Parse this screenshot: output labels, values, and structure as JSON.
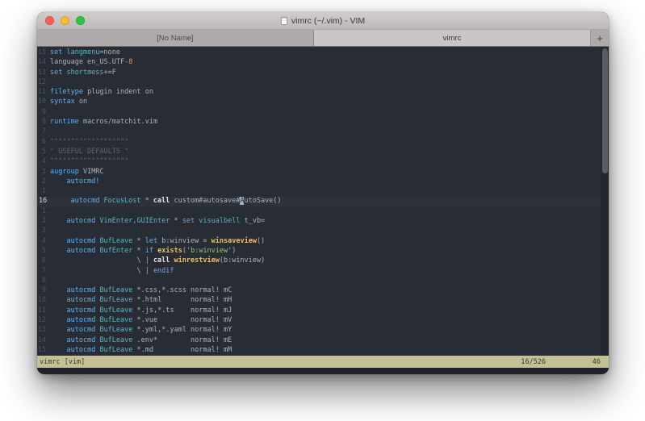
{
  "window": {
    "title": "vimrc (~/.vim) - VIM",
    "tabs": [
      {
        "label": "[No Name]",
        "active": false
      },
      {
        "label": "vimrc",
        "active": true
      }
    ],
    "new_tab_label": "+"
  },
  "theme": {
    "bg": "#282c34",
    "cursorline_bg": "#2c313a",
    "fg": "#abb2bf",
    "gutter": "#4b5263",
    "gutter_current": "#d7dae0",
    "blue": "#61afef",
    "cyan": "#56b6c2",
    "yellow": "#e5c07b",
    "green": "#98c379",
    "orange": "#d19a66",
    "comment": "#5f6672",
    "bright": "#dfe2e7",
    "cursor_bg": "#a9b2bf",
    "status_bg": "#c6c192",
    "status_fg": "#3a3829"
  },
  "editor": {
    "lines": [
      {
        "g": "15",
        "segments": [
          {
            "t": "set ",
            "c": "kw"
          },
          {
            "t": "langmenu",
            "c": "type"
          },
          {
            "t": "=none",
            "c": "pln"
          }
        ]
      },
      {
        "g": "14",
        "segments": [
          {
            "t": "language en_US.UTF",
            "c": "pln"
          },
          {
            "t": "-8",
            "c": "num"
          }
        ]
      },
      {
        "g": "13",
        "segments": [
          {
            "t": "set ",
            "c": "kw"
          },
          {
            "t": "shortmess",
            "c": "type"
          },
          {
            "t": "+=F",
            "c": "pln"
          }
        ]
      },
      {
        "g": "12",
        "segments": []
      },
      {
        "g": "11",
        "segments": [
          {
            "t": "filetype",
            "c": "kw"
          },
          {
            "t": " plugin indent on",
            "c": "pln"
          }
        ]
      },
      {
        "g": "10",
        "segments": [
          {
            "t": "syntax",
            "c": "kw"
          },
          {
            "t": " on",
            "c": "pln"
          }
        ]
      },
      {
        "g": "9",
        "segments": []
      },
      {
        "g": "8",
        "segments": [
          {
            "t": "runtime",
            "c": "kw"
          },
          {
            "t": " macros/matchit.vim",
            "c": "pln"
          }
        ]
      },
      {
        "g": "7",
        "segments": []
      },
      {
        "g": "6",
        "segments": [
          {
            "t": "\"\"\"\"\"\"\"\"\"\"\"\"\"\"\"\"\"\"\"",
            "c": "cmt"
          }
        ]
      },
      {
        "g": "5",
        "segments": [
          {
            "t": "\" USEFUL DEFAULTS \"",
            "c": "cmt"
          }
        ]
      },
      {
        "g": "4",
        "segments": [
          {
            "t": "\"\"\"\"\"\"\"\"\"\"\"\"\"\"\"\"\"\"\"",
            "c": "cmt"
          }
        ]
      },
      {
        "g": "3",
        "segments": [
          {
            "t": "augroup",
            "c": "kw"
          },
          {
            "t": " VIMRC",
            "c": "pln"
          }
        ]
      },
      {
        "g": "2",
        "segments": [
          {
            "t": "    ",
            "c": "pln"
          },
          {
            "t": "autocmd!",
            "c": "kw"
          }
        ]
      },
      {
        "g": "1",
        "segments": []
      },
      {
        "g": "16",
        "current": true,
        "segments": [
          {
            "t": "    ",
            "c": "pln"
          },
          {
            "t": "autocmd",
            "c": "kw"
          },
          {
            "t": " ",
            "c": "pln"
          },
          {
            "t": "FocusLost",
            "c": "type"
          },
          {
            "t": " * ",
            "c": "pln"
          },
          {
            "t": "call",
            "c": "cmd"
          },
          {
            "t": " custom#autosave#",
            "c": "pln"
          },
          {
            "t": "A",
            "c": "cursor"
          },
          {
            "t": "utoSave()",
            "c": "pln"
          }
        ]
      },
      {
        "g": "1",
        "segments": []
      },
      {
        "g": "2",
        "segments": [
          {
            "t": "    ",
            "c": "pln"
          },
          {
            "t": "autocmd",
            "c": "kw"
          },
          {
            "t": " ",
            "c": "pln"
          },
          {
            "t": "VimEnter,GUIEnter",
            "c": "type"
          },
          {
            "t": " * ",
            "c": "pln"
          },
          {
            "t": "set",
            "c": "kw"
          },
          {
            "t": " ",
            "c": "pln"
          },
          {
            "t": "visualbell",
            "c": "type"
          },
          {
            "t": " t_vb=",
            "c": "pln"
          }
        ]
      },
      {
        "g": "3",
        "segments": []
      },
      {
        "g": "4",
        "segments": [
          {
            "t": "    ",
            "c": "pln"
          },
          {
            "t": "autocmd",
            "c": "kw"
          },
          {
            "t": " ",
            "c": "pln"
          },
          {
            "t": "BufLeave",
            "c": "type"
          },
          {
            "t": " * ",
            "c": "pln"
          },
          {
            "t": "let",
            "c": "kw"
          },
          {
            "t": " b:winview = ",
            "c": "pln"
          },
          {
            "t": "winsaveview",
            "c": "fn"
          },
          {
            "t": "()",
            "c": "pln"
          }
        ]
      },
      {
        "g": "5",
        "segments": [
          {
            "t": "    ",
            "c": "pln"
          },
          {
            "t": "autocmd",
            "c": "kw"
          },
          {
            "t": " ",
            "c": "pln"
          },
          {
            "t": "BufEnter",
            "c": "type"
          },
          {
            "t": " * ",
            "c": "pln"
          },
          {
            "t": "if",
            "c": "kw"
          },
          {
            "t": " ",
            "c": "pln"
          },
          {
            "t": "exists",
            "c": "fn"
          },
          {
            "t": "(",
            "c": "pln"
          },
          {
            "t": "'b:winview'",
            "c": "str"
          },
          {
            "t": ")",
            "c": "pln"
          }
        ]
      },
      {
        "g": "6",
        "segments": [
          {
            "t": "                     \\ | ",
            "c": "pln"
          },
          {
            "t": "call",
            "c": "cmd"
          },
          {
            "t": " ",
            "c": "pln"
          },
          {
            "t": "winrestview",
            "c": "fn"
          },
          {
            "t": "(b:winview)",
            "c": "pln"
          }
        ]
      },
      {
        "g": "7",
        "segments": [
          {
            "t": "                     \\ | ",
            "c": "pln"
          },
          {
            "t": "endif",
            "c": "kw"
          }
        ]
      },
      {
        "g": "8",
        "segments": []
      },
      {
        "g": "9",
        "segments": [
          {
            "t": "    ",
            "c": "pln"
          },
          {
            "t": "autocmd",
            "c": "kw"
          },
          {
            "t": " ",
            "c": "pln"
          },
          {
            "t": "BufLeave",
            "c": "type"
          },
          {
            "t": " *.css,*.scss normal! mC",
            "c": "pln"
          }
        ]
      },
      {
        "g": "10",
        "segments": [
          {
            "t": "    ",
            "c": "pln"
          },
          {
            "t": "autocmd",
            "c": "kw"
          },
          {
            "t": " ",
            "c": "pln"
          },
          {
            "t": "BufLeave",
            "c": "type"
          },
          {
            "t": " *.html       normal! mH",
            "c": "pln"
          }
        ]
      },
      {
        "g": "11",
        "segments": [
          {
            "t": "    ",
            "c": "pln"
          },
          {
            "t": "autocmd",
            "c": "kw"
          },
          {
            "t": " ",
            "c": "pln"
          },
          {
            "t": "BufLeave",
            "c": "type"
          },
          {
            "t": " *.js,*.ts    normal! mJ",
            "c": "pln"
          }
        ]
      },
      {
        "g": "12",
        "segments": [
          {
            "t": "    ",
            "c": "pln"
          },
          {
            "t": "autocmd",
            "c": "kw"
          },
          {
            "t": " ",
            "c": "pln"
          },
          {
            "t": "BufLeave",
            "c": "type"
          },
          {
            "t": " *.vue        normal! mV",
            "c": "pln"
          }
        ]
      },
      {
        "g": "13",
        "segments": [
          {
            "t": "    ",
            "c": "pln"
          },
          {
            "t": "autocmd",
            "c": "kw"
          },
          {
            "t": " ",
            "c": "pln"
          },
          {
            "t": "BufLeave",
            "c": "type"
          },
          {
            "t": " *.yml,*.yaml normal! mY",
            "c": "pln"
          }
        ]
      },
      {
        "g": "14",
        "segments": [
          {
            "t": "    ",
            "c": "pln"
          },
          {
            "t": "autocmd",
            "c": "kw"
          },
          {
            "t": " ",
            "c": "pln"
          },
          {
            "t": "BufLeave",
            "c": "type"
          },
          {
            "t": " .env*        normal! mE",
            "c": "pln"
          }
        ]
      },
      {
        "g": "15",
        "segments": [
          {
            "t": "    ",
            "c": "pln"
          },
          {
            "t": "autocmd",
            "c": "kw"
          },
          {
            "t": " ",
            "c": "pln"
          },
          {
            "t": "BufLeave",
            "c": "type"
          },
          {
            "t": " *.md         normal! mM",
            "c": "pln"
          }
        ]
      }
    ]
  },
  "statusline": {
    "left": "vimrc [vim]",
    "position": "16/526",
    "column": "46"
  }
}
